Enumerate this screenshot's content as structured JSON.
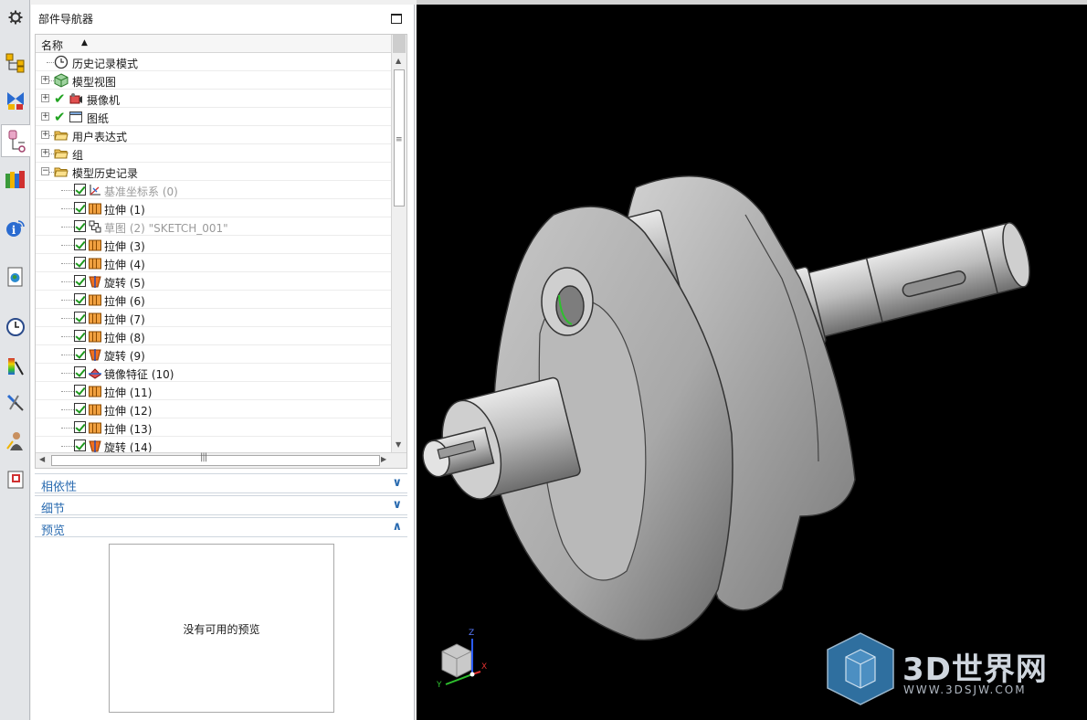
{
  "navigator": {
    "title": "部件导航器",
    "column_name": "名称",
    "rows": [
      {
        "label": "历史记录模式"
      },
      {
        "label": "模型视图"
      },
      {
        "label": "摄像机"
      },
      {
        "label": "图纸"
      },
      {
        "label": "用户表达式"
      },
      {
        "label": "组"
      },
      {
        "label": "模型历史记录"
      },
      {
        "label": "基准坐标系 (0)"
      },
      {
        "label": "拉伸 (1)"
      },
      {
        "label": "草图 (2) \"SKETCH_001\""
      },
      {
        "label": "拉伸 (3)"
      },
      {
        "label": "拉伸 (4)"
      },
      {
        "label": "旋转 (5)"
      },
      {
        "label": "拉伸 (6)"
      },
      {
        "label": "拉伸 (7)"
      },
      {
        "label": "拉伸 (8)"
      },
      {
        "label": "旋转 (9)"
      },
      {
        "label": "镜像特征 (10)"
      },
      {
        "label": "拉伸 (11)"
      },
      {
        "label": "拉伸 (12)"
      },
      {
        "label": "拉伸 (13)"
      },
      {
        "label": "旋转 (14)"
      }
    ]
  },
  "sections": {
    "dependencies": "相依性",
    "details": "细节",
    "preview": "预览",
    "preview_empty": "没有可用的预览"
  },
  "triad": {
    "x": "X",
    "y": "Y",
    "z": "Z"
  },
  "watermark": {
    "name": "3D世界网",
    "url": "WWW.3DSJW.COM"
  },
  "colors": {
    "accent": "#2a6bb0",
    "check": "#1e9a1e",
    "viewport_bg": "#000000"
  }
}
